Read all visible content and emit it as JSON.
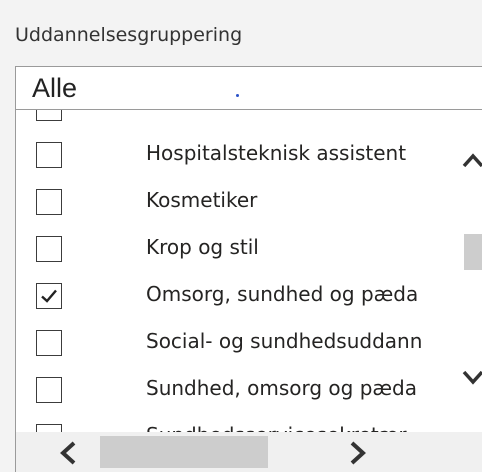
{
  "filter": {
    "label": "Uddannelsesgruppering",
    "selected_value": "Alle"
  },
  "list": {
    "items": [
      {
        "label": "",
        "checked": false
      },
      {
        "label": "Hospitalsteknisk assistent",
        "checked": false
      },
      {
        "label": "Kosmetiker",
        "checked": false
      },
      {
        "label": "Krop og stil",
        "checked": false
      },
      {
        "label": "Omsorg, sundhed og pæda",
        "checked": true
      },
      {
        "label": "Social- og sundhedsuddann",
        "checked": false
      },
      {
        "label": "Sundhed, omsorg og pæda",
        "checked": false
      },
      {
        "label": "Sundhedsservicesekretær",
        "checked": false
      }
    ]
  },
  "icons": {
    "scroll_up": "chevron-up-icon",
    "scroll_down": "chevron-down-icon",
    "scroll_left": "chevron-left-icon",
    "scroll_right": "chevron-right-icon",
    "checkmark": "checkmark-icon"
  }
}
